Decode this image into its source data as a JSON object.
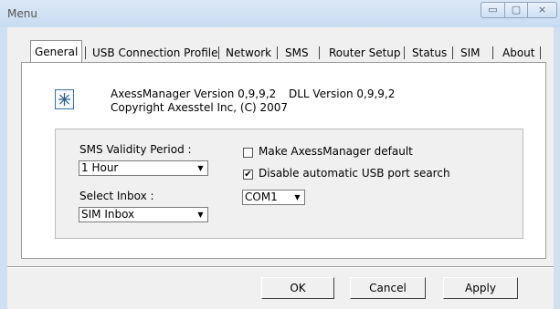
{
  "window": {
    "title": "Menu",
    "controls": {
      "minimize": "▭",
      "maximize": "▢",
      "close": "⨯"
    }
  },
  "tabs": [
    {
      "label": "General",
      "selected": true
    },
    {
      "label": "USB Connection Profile"
    },
    {
      "label": "Network"
    },
    {
      "label": "SMS"
    },
    {
      "label": "Router Setup"
    },
    {
      "label": "Status"
    },
    {
      "label": "SIM"
    },
    {
      "label": "About"
    }
  ],
  "info": {
    "version": "AxessManager Version 0,9,9,2",
    "dll_version": "DLL Version 0,9,9,2",
    "copyright": "Copyright Axesstel Inc, (C) 2007",
    "icon": "app-logo-icon"
  },
  "settings": {
    "sms_validity_label": "SMS Validity Period :",
    "sms_validity_value": "1 Hour",
    "select_inbox_label": "Select Inbox :",
    "select_inbox_value": "SIM Inbox",
    "make_default_label": "Make AxessManager default",
    "make_default_checked": false,
    "disable_usb_search_label": "Disable automatic USB port search",
    "disable_usb_search_checked": true,
    "port_value": "COM1"
  },
  "buttons": {
    "ok": "OK",
    "cancel": "Cancel",
    "apply": "Apply"
  }
}
